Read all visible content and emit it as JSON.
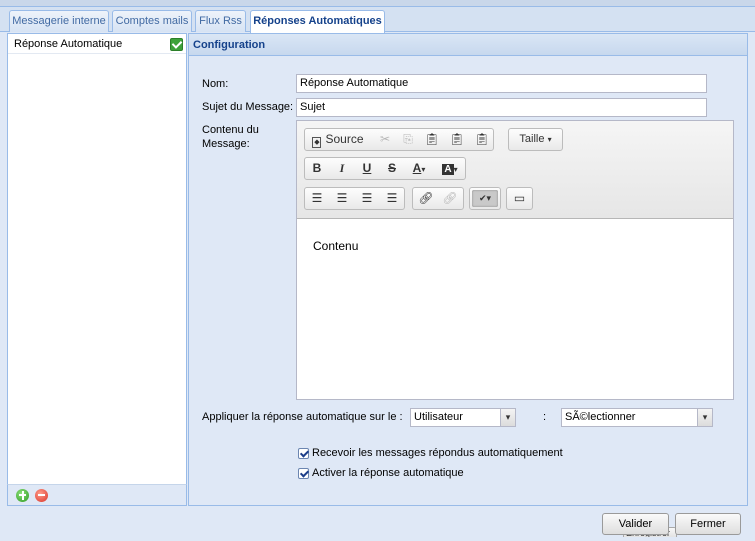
{
  "tabs": [
    {
      "label": "Messagerie interne",
      "active": false
    },
    {
      "label": "Comptes mails",
      "active": false
    },
    {
      "label": "Flux Rss",
      "active": false
    },
    {
      "label": "Réponses Automatiques",
      "active": true
    }
  ],
  "left_list": {
    "items": [
      {
        "label": "Réponse Automatique",
        "status_icon": "check-icon"
      }
    ]
  },
  "config": {
    "title": "Configuration",
    "nom_label": "Nom:",
    "nom_value": "Réponse Automatique",
    "sujet_label": "Sujet du Message:",
    "sujet_value": "Sujet",
    "contenu_label_line1": "Contenu du",
    "contenu_label_line2": "Message:",
    "editor": {
      "source_label": "Source",
      "taille_label": "Taille",
      "content_text": "Contenu"
    },
    "apply_label": "Appliquer la réponse automatique sur le :",
    "apply_type_value": "Utilisateur",
    "colon": ":",
    "apply_target_value": "SÃ©lectionner",
    "checkbox_receive_label": "Recevoir les messages répondus automatiquement",
    "checkbox_receive_checked": true,
    "checkbox_activate_label": "Activer la réponse automatique",
    "checkbox_activate_checked": true,
    "save_partial_label": "Enregistrer"
  },
  "footer": {
    "valider_label": "Valider",
    "fermer_label": "Fermer"
  }
}
